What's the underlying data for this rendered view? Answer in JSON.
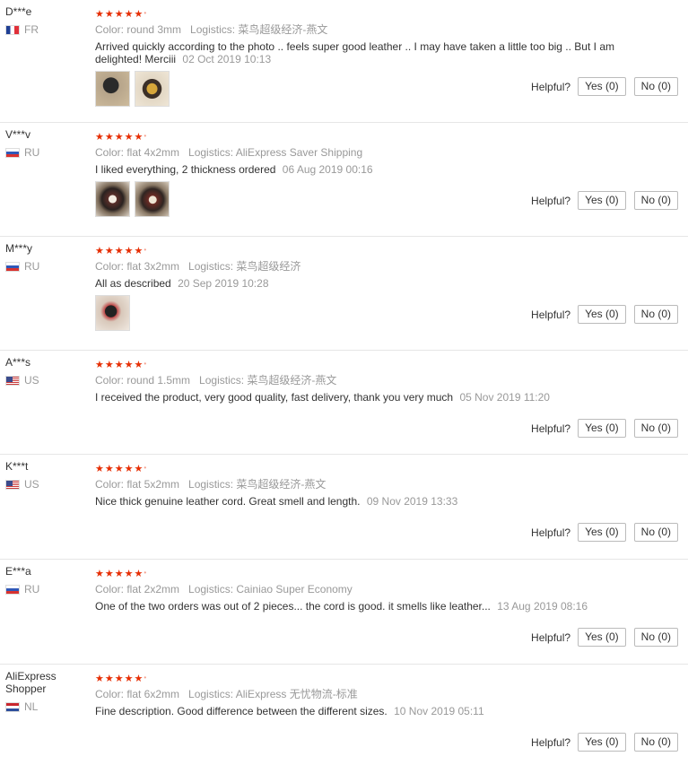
{
  "helpful_label": "Helpful?",
  "reviews": [
    {
      "user": "D***e",
      "country": "FR",
      "stars": "★★★★★",
      "color": "Color: round 3mm",
      "logistics": "Logistics: 菜鸟超级经济-燕文",
      "text": "Arrived quickly according to the photo .. feels super good leather .. I may have taken a little too big .. But I am delighted! Merciii",
      "date": "02 Oct 2019 10:13",
      "yes": "Yes (0)",
      "no": "No (0)"
    },
    {
      "user": "V***v",
      "country": "RU",
      "stars": "★★★★★",
      "color": "Color: flat 4x2mm",
      "logistics": "Logistics: AliExpress Saver Shipping",
      "text": "I liked everything, 2 thickness ordered",
      "date": "06 Aug 2019 00:16",
      "yes": "Yes (0)",
      "no": "No (0)"
    },
    {
      "user": "M***y",
      "country": "RU",
      "stars": "★★★★★",
      "color": "Color: flat 3x2mm",
      "logistics": "Logistics: 菜鸟超级经济",
      "text": "All as described",
      "date": "20 Sep 2019 10:28",
      "yes": "Yes (0)",
      "no": "No (0)"
    },
    {
      "user": "A***s",
      "country": "US",
      "stars": "★★★★★",
      "color": "Color: round 1.5mm",
      "logistics": "Logistics: 菜鸟超级经济-燕文",
      "text": "I received the product, very good quality, fast delivery, thank you very much",
      "date": "05 Nov 2019 11:20",
      "yes": "Yes (0)",
      "no": "No (0)"
    },
    {
      "user": "K***t",
      "country": "US",
      "stars": "★★★★★",
      "color": "Color: flat 5x2mm",
      "logistics": "Logistics: 菜鸟超级经济-燕文",
      "text": "Nice thick genuine leather cord. Great smell and length.",
      "date": "09 Nov 2019 13:33",
      "yes": "Yes (0)",
      "no": "No (0)"
    },
    {
      "user": "E***a",
      "country": "RU",
      "stars": "★★★★★",
      "color": "Color: flat 2x2mm",
      "logistics": "Logistics: Cainiao Super Economy",
      "text": "One of the two orders was out of 2 pieces... the cord is good. it smells like leather...",
      "date": "13 Aug 2019 08:16",
      "yes": "Yes (0)",
      "no": "No (0)"
    },
    {
      "user": "AliExpress Shopper",
      "country": "NL",
      "stars": "★★★★★",
      "color": "Color: flat 6x2mm",
      "logistics": "Logistics: AliExpress 无忧物流-标准",
      "text": "Fine description. Good difference between the different sizes.",
      "date": "10 Nov 2019 05:11",
      "yes": "Yes (0)",
      "no": "No (0)"
    }
  ]
}
